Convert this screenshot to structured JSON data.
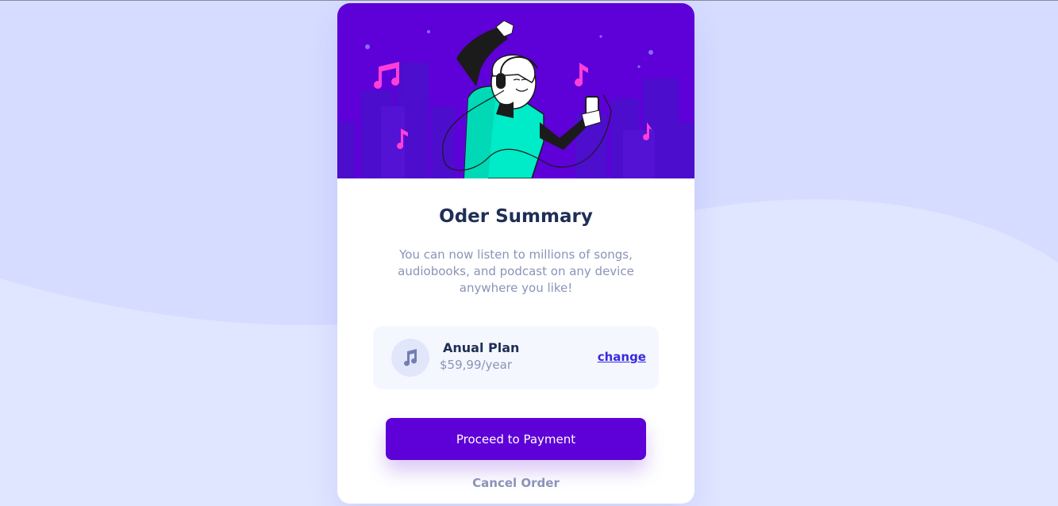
{
  "colors": {
    "background": "#e0e6ff",
    "wave": "#d6dcff",
    "hero": "#5e00d8",
    "primary": "#5e00d8",
    "link": "#3829e0",
    "title": "#1f2f56",
    "muted": "#8b93b8"
  },
  "card": {
    "title": "Oder Summary",
    "description": "You can now listen to millions of songs, audiobooks, and podcast on any device anywhere you like!",
    "plan": {
      "icon": "music-note-icon",
      "name": "Anual Plan",
      "price": "$59,99/year",
      "change_label": "change"
    },
    "primary_button": "Proceed to Payment",
    "secondary_button": "Cancel Order"
  }
}
